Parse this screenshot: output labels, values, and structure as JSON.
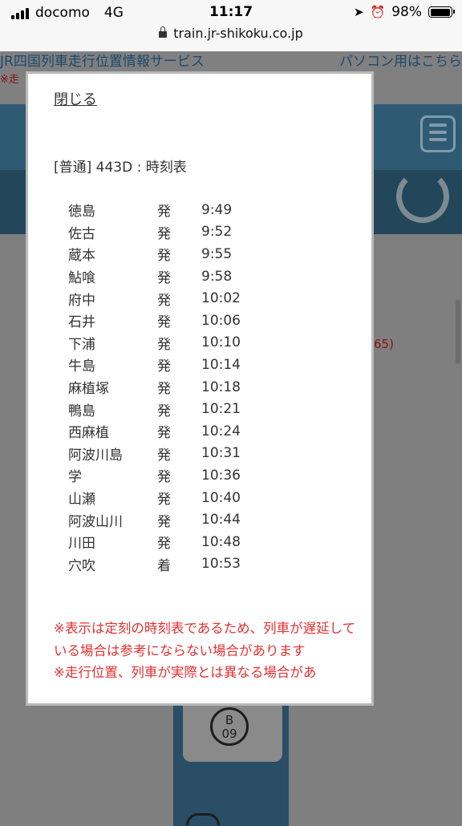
{
  "status_bar": {
    "carrier": "docomo",
    "network": "4G",
    "time": "11:17",
    "battery": "98%",
    "battery_level": 0.98,
    "url": "train.jr-shikoku.co.jp"
  },
  "background": {
    "site_title": "JR四国列車走行位置情報サービス",
    "pc_link": "パソコン用はこちら",
    "note_fragment": "※走",
    "red_fragment": "65)",
    "station_badge": "B\n09"
  },
  "modal": {
    "close_label": "閉じる",
    "title": "[普通] 443D : 時刻表",
    "rows": [
      {
        "station": "徳島",
        "type": "発",
        "time": "9:49"
      },
      {
        "station": "佐古",
        "type": "発",
        "time": "9:52"
      },
      {
        "station": "蔵本",
        "type": "発",
        "time": "9:55"
      },
      {
        "station": "鮎喰",
        "type": "発",
        "time": "9:58"
      },
      {
        "station": "府中",
        "type": "発",
        "time": "10:02"
      },
      {
        "station": "石井",
        "type": "発",
        "time": "10:06"
      },
      {
        "station": "下浦",
        "type": "発",
        "time": "10:10"
      },
      {
        "station": "牛島",
        "type": "発",
        "time": "10:14"
      },
      {
        "station": "麻植塚",
        "type": "発",
        "time": "10:18"
      },
      {
        "station": "鴨島",
        "type": "発",
        "time": "10:21"
      },
      {
        "station": "西麻植",
        "type": "発",
        "time": "10:24"
      },
      {
        "station": "阿波川島",
        "type": "発",
        "time": "10:31"
      },
      {
        "station": "学",
        "type": "発",
        "time": "10:36"
      },
      {
        "station": "山瀬",
        "type": "発",
        "time": "10:40"
      },
      {
        "station": "阿波山川",
        "type": "発",
        "time": "10:44"
      },
      {
        "station": "川田",
        "type": "発",
        "time": "10:48"
      },
      {
        "station": "穴吹",
        "type": "着",
        "time": "10:53"
      }
    ],
    "notes": [
      "※表示は定刻の時刻表であるため、列車が遅延している場合は参考にならない場合があります",
      "※走行位置、列車が実際とは異なる場合があ"
    ]
  },
  "colors": {
    "overlay_bg": "#7f7f7f",
    "note_red": "#e33030",
    "header_band": "#2f5a73"
  }
}
